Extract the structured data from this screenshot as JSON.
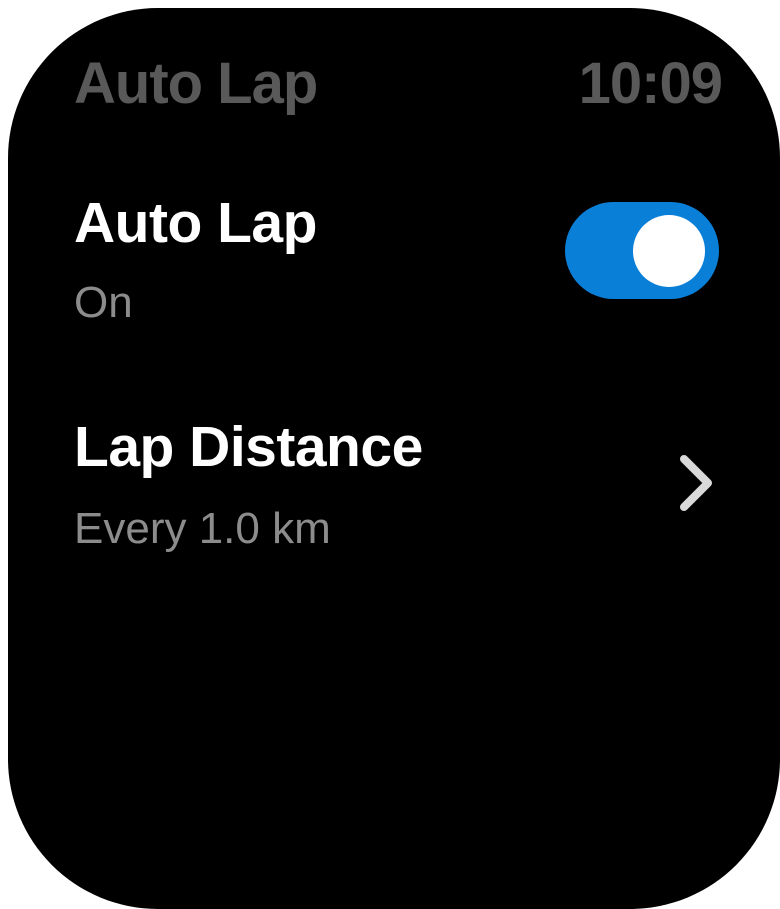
{
  "header": {
    "title": "Auto Lap",
    "time": "10:09"
  },
  "settings": {
    "auto_lap": {
      "label": "Auto Lap",
      "status": "On",
      "enabled": true,
      "accent_color": "#0a7fd8"
    },
    "lap_distance": {
      "label": "Lap Distance",
      "value": "Every 1.0 km",
      "icon": "chevron-right-icon"
    }
  },
  "colors": {
    "background": "#000000",
    "title_text": "#ffffff",
    "secondary_text": "#8c8c8c",
    "header_text": "#595959"
  }
}
